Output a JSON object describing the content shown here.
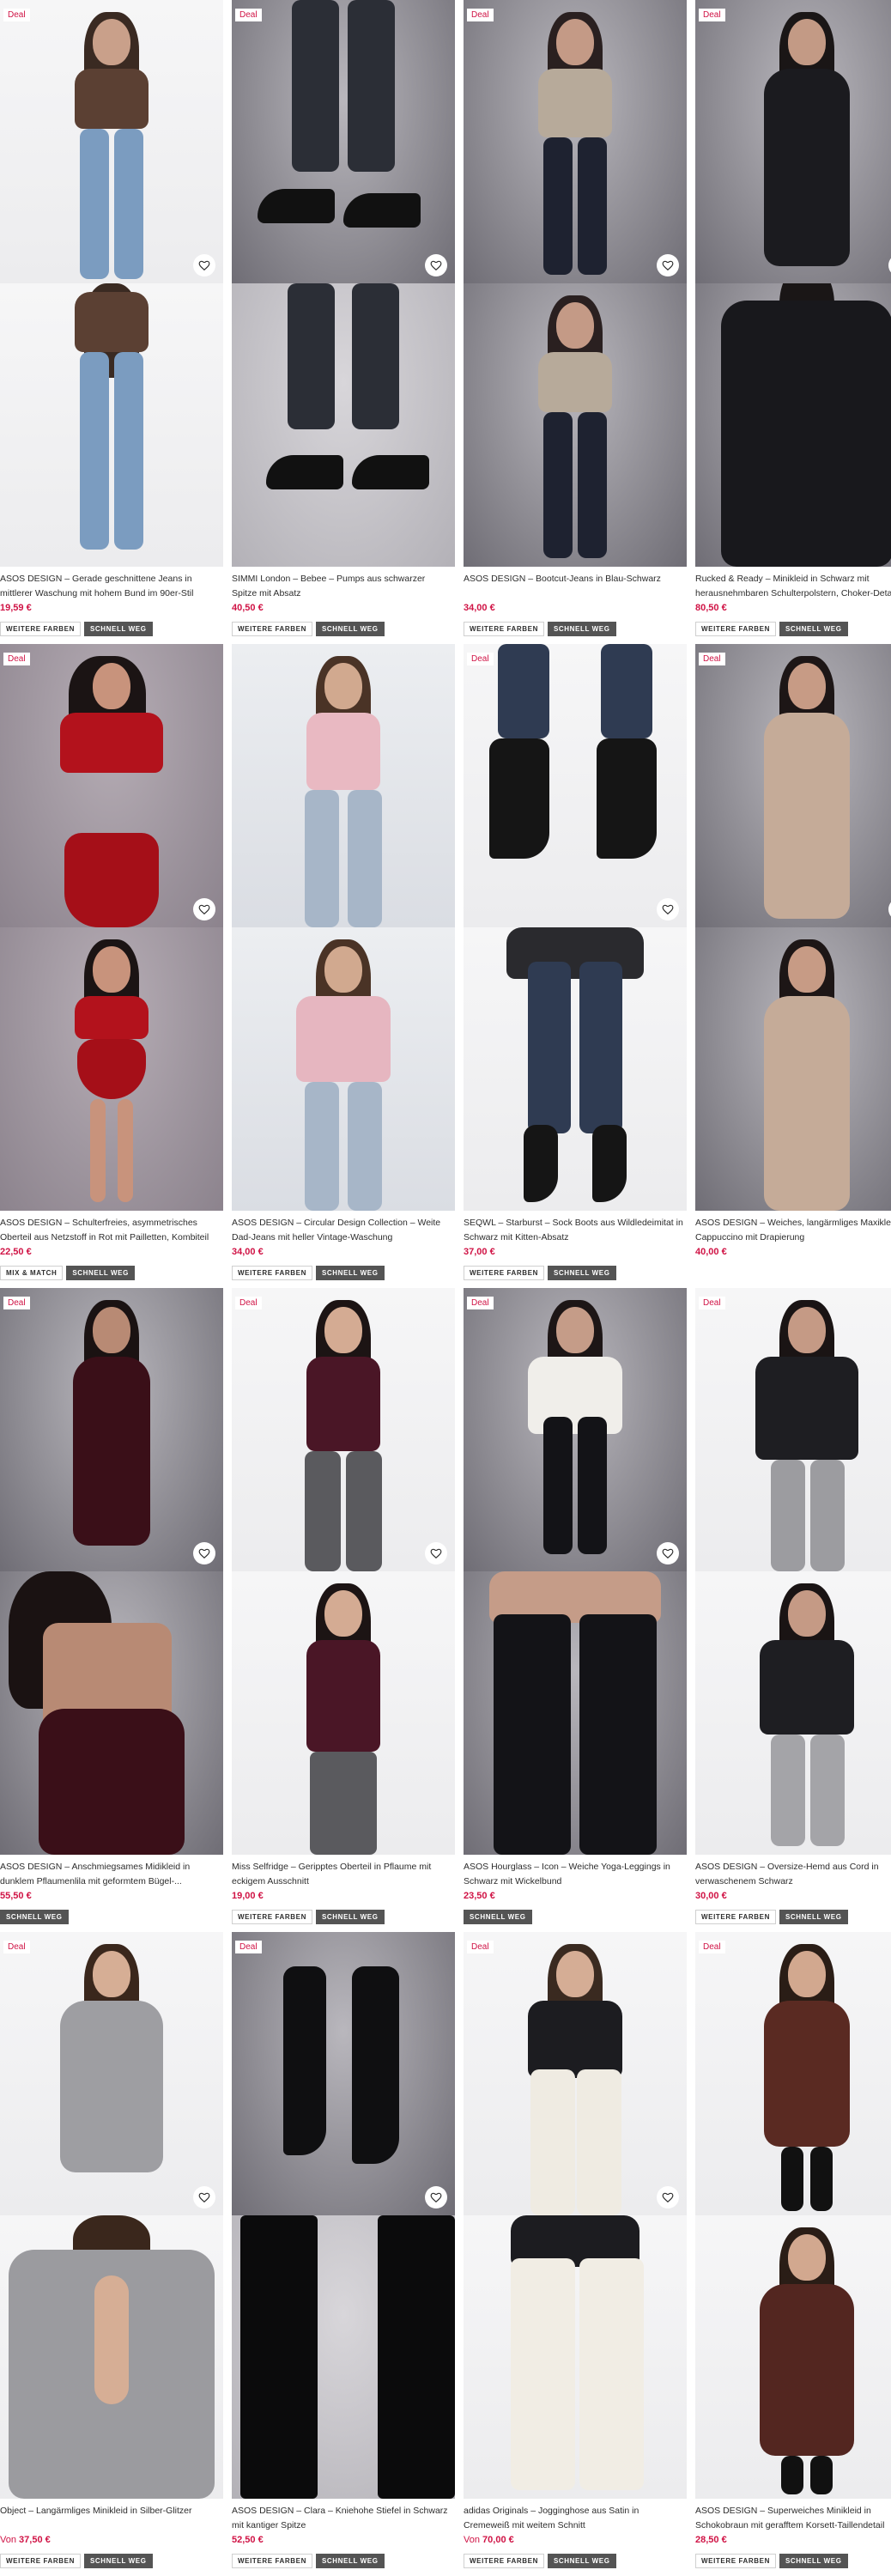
{
  "labels": {
    "deal": "Deal",
    "more_colors": "WEITERE FARBEN",
    "quick_view": "SCHNELL WEG",
    "mix_match": "MIX & MATCH",
    "from": "Von"
  },
  "products": [
    {
      "title": "ASOS DESIGN – Gerade geschnittene Jeans in mittlerer Waschung mit hohem Bund im 90er-Stil",
      "price": "19,59 €",
      "deal": true
    },
    {
      "title": "SIMMI London – Bebee – Pumps aus schwarzer Spitze mit Absatz",
      "price": "40,50 €",
      "deal": true
    },
    {
      "title": "ASOS DESIGN – Bootcut-Jeans in Blau-Schwarz",
      "price": "34,00 €",
      "deal": true
    },
    {
      "title": "Rucked & Ready – Minikleid in Schwarz mit herausnehmbaren Schulterpolstern, Choker-Detail",
      "price": "80,50 €",
      "deal": true
    },
    {
      "title": "ASOS DESIGN – Schulterfreies, asymmetrisches Oberteil aus Netzstoff in Rot mit Pailletten, Kombiteil",
      "price": "22,50 €",
      "deal": true
    },
    {
      "title": "ASOS DESIGN – Circular Design Collection – Weite Dad-Jeans mit heller Vintage-Waschung",
      "price": "34,00 €",
      "deal": false
    },
    {
      "title": "SEQWL – Starburst – Sock Boots aus Wildledeimitat in Schwarz mit Kitten-Absatz",
      "price": "37,00 €",
      "deal": true
    },
    {
      "title": "ASOS DESIGN – Weiches, langärmliges Maxikleid in Cappuccino mit Drapierung",
      "price": "40,00 €",
      "deal": true
    },
    {
      "title": "ASOS DESIGN – Anschmiegsames Midikleid in dunklem Pflaumenlila mit geformtem Bügel-...",
      "price": "55,50 €",
      "deal": true
    },
    {
      "title": "Miss Selfridge – Geripptes Oberteil in Pflaume mit eckigem Ausschnitt",
      "price": "19,00 €",
      "deal": true
    },
    {
      "title": "ASOS Hourglass – Icon – Weiche Yoga-Leggings in Schwarz mit Wickelbund",
      "price": "23,50 €",
      "deal": true
    },
    {
      "title": "ASOS DESIGN – Oversize-Hemd aus Cord in verwaschenem Schwarz",
      "price": "30,00 €",
      "deal": true
    },
    {
      "title": "Object – Langärmliges Minikleid in Silber-Glitzer",
      "price": "37,50 €",
      "from": true,
      "deal": true
    },
    {
      "title": "ASOS DESIGN – Clara – Kniehohe Stiefel in Schwarz mit kantiger Spitze",
      "price": "52,50 €",
      "deal": true
    },
    {
      "title": "adidas Originals – Jogginghose aus Satin in Cremeweiß mit weitem Schnitt",
      "price": "70,00 €",
      "from": true,
      "deal": true
    },
    {
      "title": "ASOS DESIGN – Superweiches Minikleid in Schokobraun mit gerafftem Korsett-Taillendetail",
      "price": "28,50 €",
      "deal": true
    }
  ],
  "colors": {
    "accent": "#d01345",
    "badge_dark": "#545454"
  }
}
